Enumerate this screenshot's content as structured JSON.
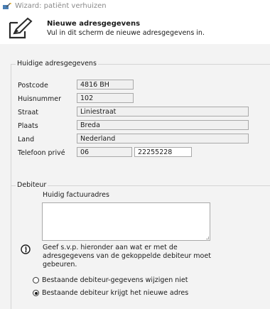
{
  "window": {
    "title": "Wizard: patiënt verhuizen"
  },
  "header": {
    "title": "Nieuwe adresgegevens",
    "subtitle": "Vul in dit scherm de nieuwe adresgegevens in."
  },
  "current_address": {
    "legend": "Huidige adresgegevens",
    "postcode_label": "Postcode",
    "postcode": "4816 BH",
    "huisnummer_label": "Huisnummer",
    "huisnummer": "102",
    "straat_label": "Straat",
    "straat": "Liniestraat",
    "plaats_label": "Plaats",
    "plaats": "Breda",
    "land_label": "Land",
    "land": "Nederland",
    "telefoon_label": "Telefoon privé",
    "telefoon_netnummer": "06",
    "telefoon_nummer": "22255228"
  },
  "debiteur": {
    "legend": "Debiteur",
    "factuuradres_label": "Huidig factuuradres",
    "factuuradres": "",
    "info_text": "Geef s.v.p. hieronder aan wat er met de adresgegevens van de gekoppelde debiteur moet gebeuren.",
    "option_keep": "Bestaande debiteur-gegevens wijzigen niet",
    "option_new": "Bestaande debiteur krijgt het nieuwe adres",
    "selected": "option_new"
  }
}
